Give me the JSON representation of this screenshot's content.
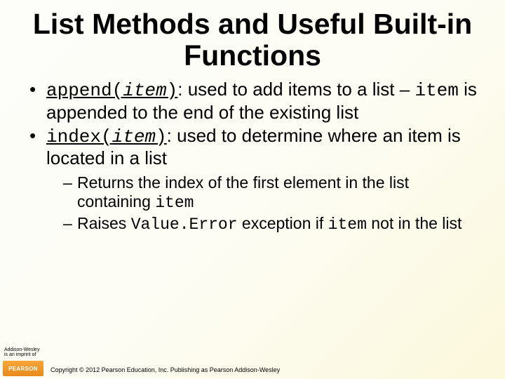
{
  "title": "List Methods and Useful Built-in Functions",
  "bullets": [
    {
      "method": "append(",
      "param": "item",
      "close": ")",
      "after_colon": ": used to add items to a list – ",
      "inline_code": "item",
      "after_inline": " is appended to the end of the existing list"
    },
    {
      "method": "index(",
      "param": "item",
      "close": ")",
      "after_colon": ": used to determine where an item is located in a list",
      "sub": [
        {
          "pre": "Returns the index of the first element in the list containing ",
          "code": "item",
          "post": ""
        },
        {
          "pre": "Raises ",
          "code": "Value.Error",
          "mid": " exception if ",
          "code2": "item",
          "post": " not in the list"
        }
      ]
    }
  ],
  "footer": {
    "imprint_line1": "Addison-Wesley",
    "imprint_line2": "is an imprint of",
    "logo": "PEARSON",
    "copyright": "Copyright © 2012 Pearson Education, Inc. Publishing as Pearson Addison-Wesley"
  }
}
